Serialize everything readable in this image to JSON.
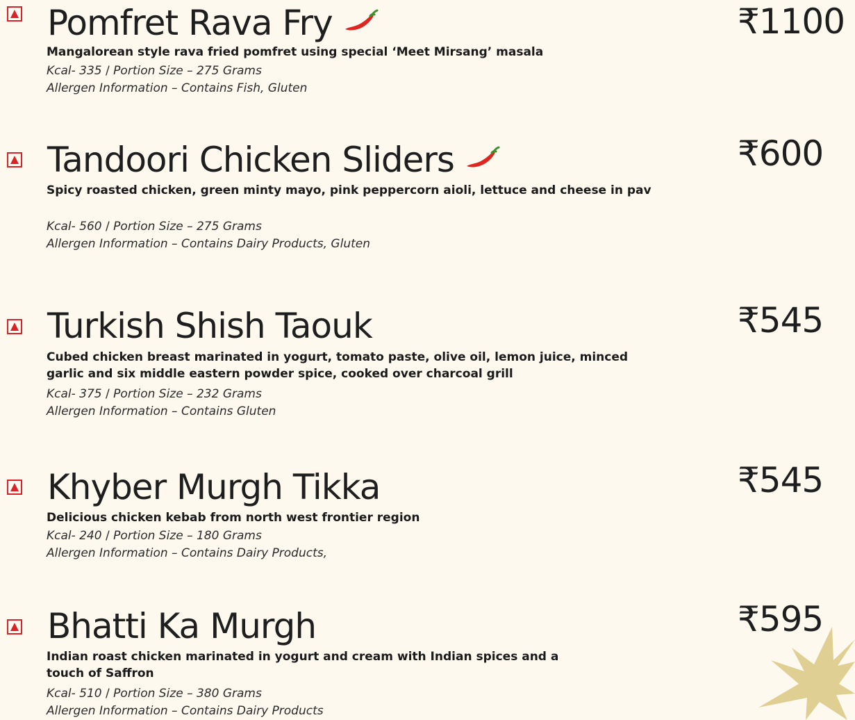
{
  "colors": {
    "background": "#fdf9ee",
    "non_veg_mark": "#d8232a",
    "chili": "#e0241f",
    "star": "#e0cf93"
  },
  "icons": {
    "non_veg_mark": "red-triangle-in-square-icon",
    "spicy": "red-chili-icon",
    "decoration": "gold-starburst"
  },
  "items": [
    {
      "name": "Pomfret Rava Fry",
      "spicy": true,
      "price": "₹1100",
      "description": "Mangalorean style rava fried pomfret using special ‘Meet Mirsang’ masala",
      "kcal": "Kcal- 335",
      "separator": "/",
      "portion": "Portion Size – 275 Grams",
      "allergen": "Allergen Information – Contains Fish, Gluten"
    },
    {
      "name": "Tandoori Chicken Sliders",
      "spicy": true,
      "price": "₹600",
      "description": "Spicy roasted chicken, green minty mayo, pink peppercorn aioli, lettuce and cheese in pav",
      "kcal": "Kcal- 560",
      "separator": "/",
      "portion": "Portion Size – 275 Grams",
      "allergen": "Allergen Information – Contains Dairy Products, Gluten"
    },
    {
      "name": "Turkish Shish Taouk",
      "spicy": false,
      "price": "₹545",
      "description": "Cubed chicken breast marinated in yogurt, tomato paste, olive oil, lemon juice, minced garlic and six middle eastern powder spice, cooked over charcoal grill",
      "kcal": "Kcal- 375",
      "separator": "/",
      "portion": "Portion Size – 232 Grams",
      "allergen": "Allergen Information – Contains Gluten"
    },
    {
      "name": "Khyber Murgh Tikka",
      "spicy": false,
      "price": "₹545",
      "description": "Delicious chicken kebab from north west frontier region",
      "kcal": "Kcal- 240",
      "separator": "/",
      "portion": "Portion Size – 180 Grams",
      "allergen": "Allergen Information – Contains Dairy Products,"
    },
    {
      "name": "Bhatti Ka Murgh",
      "spicy": false,
      "price": "₹595",
      "description": "Indian roast chicken marinated in yogurt and cream with Indian spices and a touch of Saffron",
      "kcal": "Kcal- 510",
      "separator": "/",
      "portion": "Portion Size – 380 Grams",
      "allergen": "Allergen Information – Contains Dairy Products"
    }
  ]
}
